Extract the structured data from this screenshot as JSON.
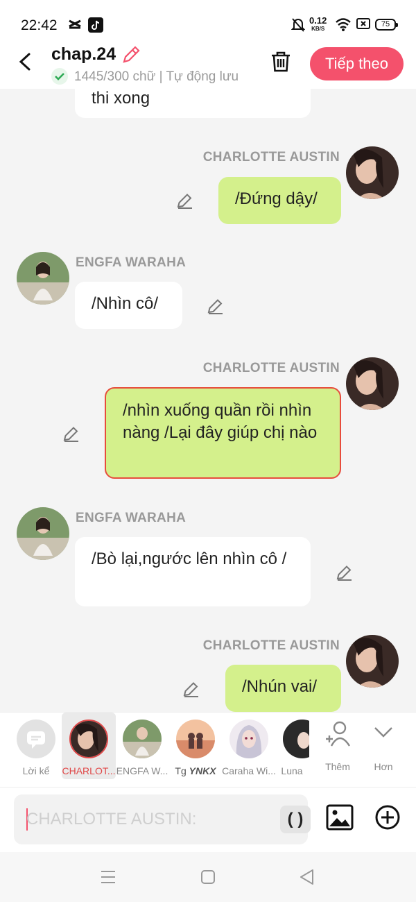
{
  "status_bar": {
    "time": "22:42",
    "net_speed": "0.12",
    "net_unit": "KB/S",
    "battery": "75"
  },
  "header": {
    "title": "chap.24",
    "subtitle": "1445/300 chữ | Tự động lưu",
    "next_label": "Tiếp theo"
  },
  "messages": [
    {
      "side": "left",
      "text": "thi xong"
    },
    {
      "side": "right",
      "name": "CHARLOTTE AUSTIN",
      "text": "/Đứng dậy/"
    },
    {
      "side": "left",
      "name": "ENGFA WARAHA",
      "text": "/Nhìn cô/"
    },
    {
      "side": "right",
      "name": "CHARLOTTE AUSTIN",
      "text": "/nhìn xuống quần rồi nhìn nàng /Lại đây giúp chị nào",
      "selected": true
    },
    {
      "side": "left",
      "name": "ENGFA WARAHA",
      "text": "/Bò lại,ngước lên nhìn cô /"
    },
    {
      "side": "right",
      "name": "CHARLOTTE AUSTIN",
      "text": "/Nhún vai/"
    }
  ],
  "characters": [
    {
      "label": "Lời kể",
      "icon": "narration-icon"
    },
    {
      "label": "CHARLOT...",
      "active": true
    },
    {
      "label": "ENGFA W..."
    },
    {
      "label": "Tg YNKX"
    },
    {
      "label": "Caraha Wi..."
    },
    {
      "label": "Luna"
    },
    {
      "label": "Thêm",
      "icon": "add-person-icon"
    },
    {
      "label": "Hơn",
      "icon": "chevron-down-icon"
    }
  ],
  "input": {
    "placeholder": "CHARLOTTE AUSTIN:",
    "paren_label": "( )"
  },
  "colors": {
    "accent": "#f4516c",
    "right_bubble": "#d4f08c",
    "left_bubble": "#ffffff",
    "background": "#f4f4f4",
    "selected_border": "#e74c3c"
  }
}
